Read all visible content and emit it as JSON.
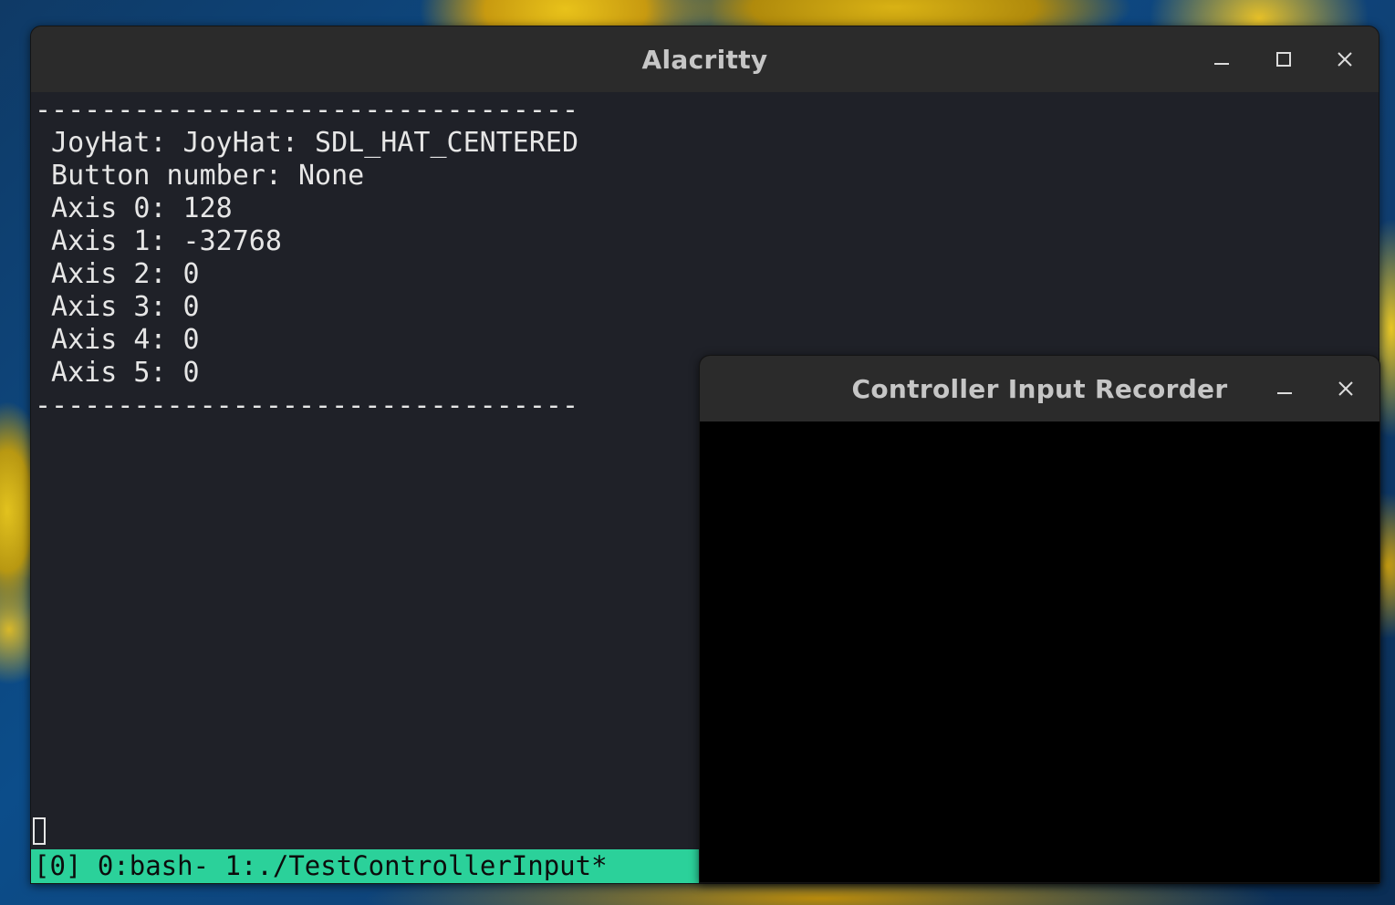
{
  "alacritty": {
    "title": "Alacritty",
    "terminal_lines": [
      "---------------------------------",
      " JoyHat: JoyHat: SDL_HAT_CENTERED",
      " Button number: None",
      " Axis 0: 128",
      " Axis 1: -32768",
      " Axis 2: 0",
      " Axis 3: 0",
      " Axis 4: 0",
      " Axis 5: 0",
      "---------------------------------"
    ],
    "status_bar": "[0] 0:bash- 1:./TestControllerInput*",
    "status_bar_color": "#2bd19a",
    "controls": [
      "minimize-icon",
      "maximize-icon",
      "close-icon"
    ]
  },
  "recorder": {
    "title": "Controller Input Recorder",
    "controls": [
      "minimize-icon",
      "close-icon"
    ]
  }
}
